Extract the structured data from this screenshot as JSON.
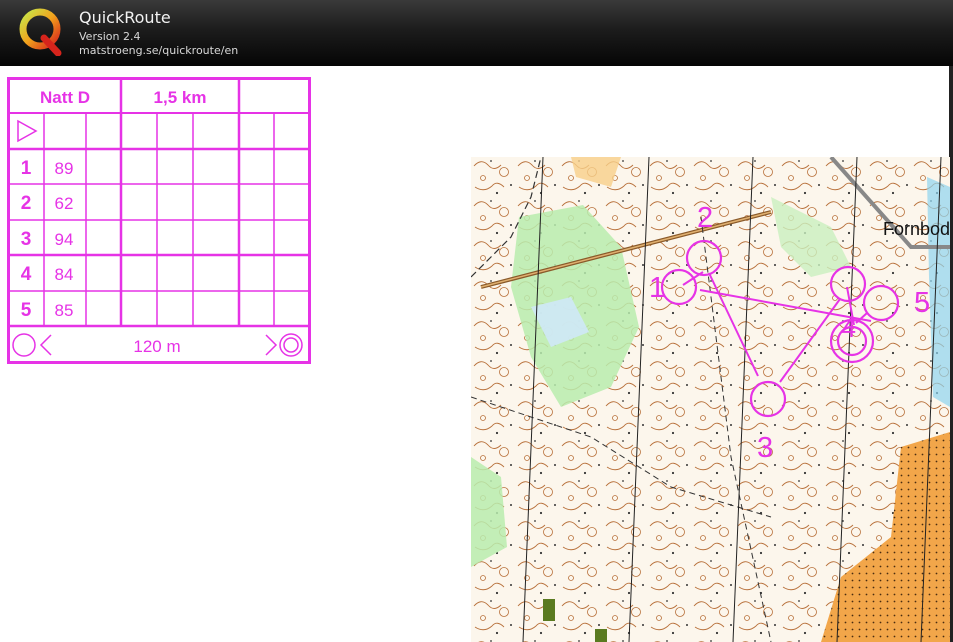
{
  "app": {
    "title": "QuickRoute",
    "version": "Version 2.4",
    "url": "matstroeng.se/quickroute/en",
    "logo_letter": "Q"
  },
  "description_sheet": {
    "event_name": "Natt D",
    "course_length": "1,5 km",
    "controls": [
      {
        "number": "1",
        "code": "89"
      },
      {
        "number": "2",
        "code": "62"
      },
      {
        "number": "3",
        "code": "94"
      },
      {
        "number": "4",
        "code": "84"
      },
      {
        "number": "5",
        "code": "85"
      }
    ],
    "finish_distance": "120 m"
  },
  "map": {
    "place_label": "Fornbod",
    "control_labels": [
      "1",
      "2",
      "3",
      "4",
      "5"
    ]
  },
  "colors": {
    "course_magenta": "#e633e6",
    "titlebar_dark": "#111111"
  }
}
